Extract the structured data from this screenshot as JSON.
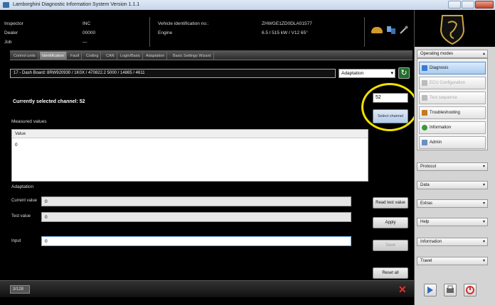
{
  "window": {
    "title": "Lamborghini Diagnostic Information System Version 1.1.1"
  },
  "header": {
    "inspector_label": "Inspector",
    "inspector_value": "INC",
    "dealer_label": "Dealer",
    "dealer_value": "00000",
    "job_label": "Job",
    "job_value": "—",
    "vin_label": "Vehicle identification no.:",
    "vin_value": "ZHWGE1ZD0DLA01577",
    "engine_label": "Engine",
    "engine_value": "6.5 l 515 kW / V12 65°"
  },
  "tabs": [
    "Control units",
    "Identification",
    "Fault",
    "Coding",
    "CAN",
    "Login/Basic",
    "Adaptation",
    "Basic Settings Wizard"
  ],
  "active_tab_index": 1,
  "ecu": {
    "selected": "17 - Dash Board: 8RW920930 / 1K0X / 470822.2 5000 / 14865 / 4611",
    "mode": "Adaptation"
  },
  "channel": {
    "label": "Currently selected channel: 52",
    "input_value": "52",
    "select_button": "Select channel"
  },
  "measured_values": {
    "label": "Measured values",
    "column": "Value",
    "value": "0"
  },
  "adaptation": {
    "label": "Adaptation",
    "current_label": "Current value",
    "current_value": "0",
    "test_label": "Test value",
    "test_value": "0",
    "input_label": "Input",
    "input_value": "0",
    "read_test_button": "Read test value",
    "apply_button": "Apply",
    "save_button": "Save",
    "reset_button": "Reset all"
  },
  "status": {
    "box": "3/128"
  },
  "right_panel": {
    "operating_modes": "Operating modes",
    "nav": [
      "Diagnosis",
      "ECU Configuration",
      "Test sequence",
      "Troubleshooting",
      "Information",
      "Admin"
    ],
    "drops": [
      "Protocol",
      "Data",
      "Extras",
      "Help",
      "Information",
      "Travel"
    ]
  },
  "colors": {
    "highlight": "#f0e000",
    "abort": "#e8302a",
    "go": "#1f6e2b"
  }
}
